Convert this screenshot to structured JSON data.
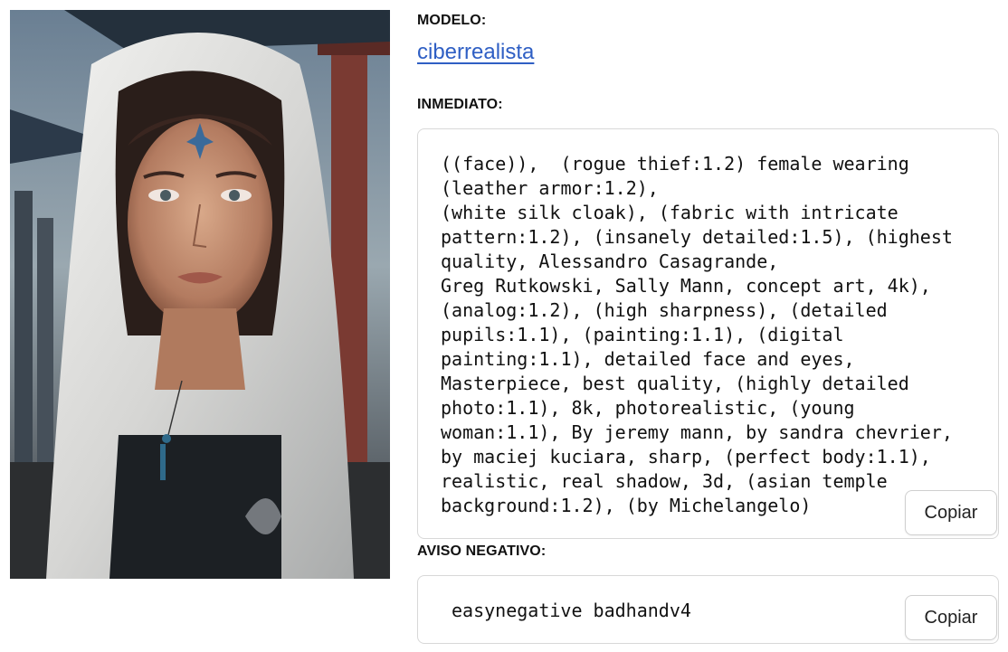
{
  "image": {
    "alt": ""
  },
  "model": {
    "label": "MODELO:",
    "name": "ciberrealista"
  },
  "prompt": {
    "label": "INMEDIATO:",
    "text": "((face)),  (rogue thief:1.2) female wearing\n(leather armor:1.2),\n(white silk cloak), (fabric with intricate\npattern:1.2), (insanely detailed:1.5), (highest\nquality, Alessandro Casagrande,\nGreg Rutkowski, Sally Mann, concept art, 4k),\n(analog:1.2), (high sharpness), (detailed\npupils:1.1), (painting:1.1), (digital\npainting:1.1), detailed face and eyes,\nMasterpiece, best quality, (highly detailed\nphoto:1.1), 8k, photorealistic, (young\nwoman:1.1), By jeremy mann, by sandra chevrier,\nby maciej kuciara, sharp, (perfect body:1.1),\nrealistic, real shadow, 3d, (asian temple\nbackground:1.2), (by Michelangelo)",
    "copy_label": "Copiar"
  },
  "negative": {
    "label": "AVISO NEGATIVO:",
    "text": "easynegative badhandv4",
    "copy_label": "Copiar"
  },
  "colors": {
    "link": "#2f5fc4",
    "border": "#d8d8d8",
    "text": "#111111"
  }
}
